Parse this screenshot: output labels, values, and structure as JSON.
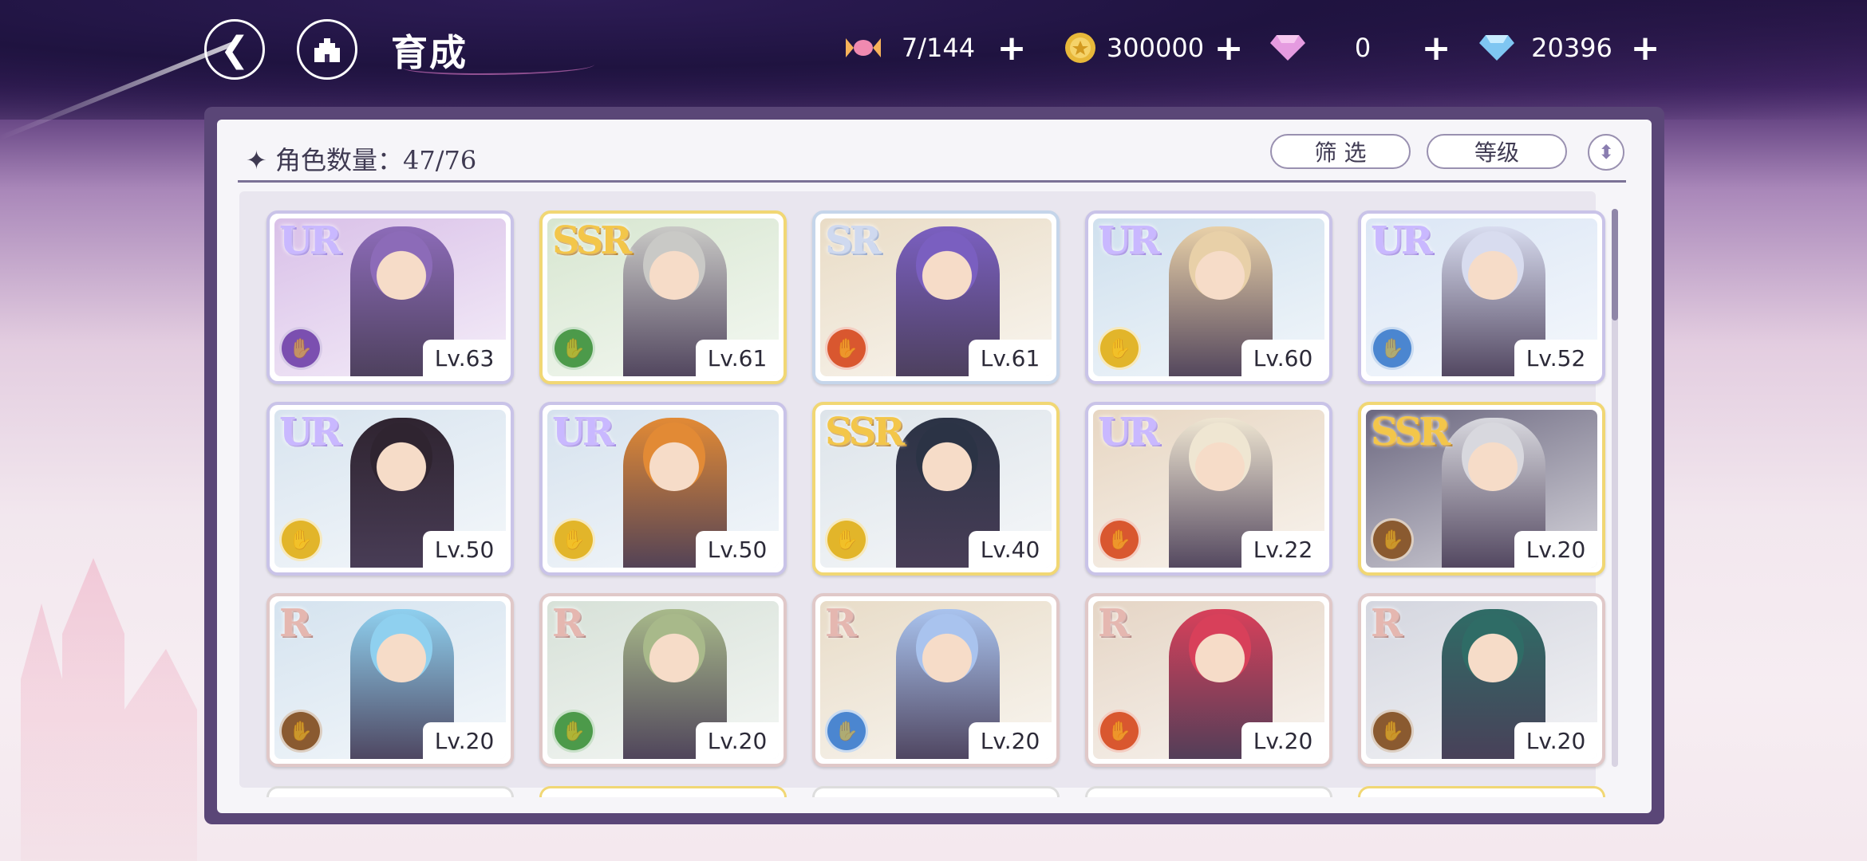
{
  "header": {
    "back_icon": "back-arrow-icon",
    "home_icon": "castle-home-icon",
    "title": "育成",
    "resources": [
      {
        "name": "candy",
        "icon": "candy-icon",
        "value": "7/144",
        "add": "+"
      },
      {
        "name": "coin",
        "icon": "coin-icon",
        "value": "300000",
        "add": "+"
      },
      {
        "name": "pink-gem",
        "icon": "pink-gem-icon",
        "value": "0",
        "add": "+"
      },
      {
        "name": "blue-gem",
        "icon": "blue-diamond-icon",
        "value": "20396",
        "add": "+"
      }
    ]
  },
  "panel": {
    "count_label": "✦ 角色数量：47/76",
    "filter_label": "筛 选",
    "sort_label": "等级",
    "sort_icon": "sort-toggle-icon"
  },
  "colors": {
    "attr_purple": "#7b4fb0",
    "attr_green": "#4c9a4a",
    "attr_red": "#d9572f",
    "attr_yellow": "#e2b52a",
    "attr_blue": "#4b86d0",
    "attr_brown": "#8a5a30"
  },
  "characters": [
    {
      "rarity": "UR",
      "level": "Lv.63",
      "attr": "purple",
      "hair": "#8c6bb8",
      "bg": "#d9c0e8"
    },
    {
      "rarity": "SSR",
      "level": "Lv.61",
      "attr": "green",
      "hair": "#c9c9c6",
      "bg": "#d7e6d0"
    },
    {
      "rarity": "SR",
      "level": "Lv.61",
      "attr": "red",
      "hair": "#7a5fc0",
      "bg": "#e9dcc6"
    },
    {
      "rarity": "UR",
      "level": "Lv.60",
      "attr": "yellow",
      "hair": "#e8d0a8",
      "bg": "#cfe0ee"
    },
    {
      "rarity": "UR",
      "level": "Lv.52",
      "attr": "blue",
      "hair": "#d8dcef",
      "bg": "#dbe6f5"
    },
    {
      "rarity": "UR",
      "level": "Lv.50",
      "attr": "yellow",
      "hair": "#2f2430",
      "bg": "#d8e4ef"
    },
    {
      "rarity": "UR",
      "level": "Lv.50",
      "attr": "yellow",
      "hair": "#e28a35",
      "bg": "#d6e2ee"
    },
    {
      "rarity": "SSR",
      "level": "Lv.40",
      "attr": "yellow",
      "hair": "#2b3345",
      "bg": "#dde4ea"
    },
    {
      "rarity": "UR",
      "level": "Lv.22",
      "attr": "red",
      "hair": "#efe6d2",
      "bg": "#e7d6c2"
    },
    {
      "rarity": "SSR",
      "level": "Lv.20",
      "attr": "brown",
      "hair": "#d8d8de",
      "bg": "#6c6880"
    },
    {
      "rarity": "R",
      "level": "Lv.20",
      "attr": "brown",
      "hair": "#8fd0ef",
      "bg": "#d5e3ef"
    },
    {
      "rarity": "R",
      "level": "Lv.20",
      "attr": "green",
      "hair": "#a8b98a",
      "bg": "#d7e1d8"
    },
    {
      "rarity": "R",
      "level": "Lv.20",
      "attr": "blue",
      "hair": "#a9c3ee",
      "bg": "#e8dcc8"
    },
    {
      "rarity": "R",
      "level": "Lv.20",
      "attr": "red",
      "hair": "#d8405a",
      "bg": "#e5d5c5"
    },
    {
      "rarity": "R",
      "level": "Lv.20",
      "attr": "brown",
      "hair": "#2f6c66",
      "bg": "#d4d6df"
    }
  ]
}
